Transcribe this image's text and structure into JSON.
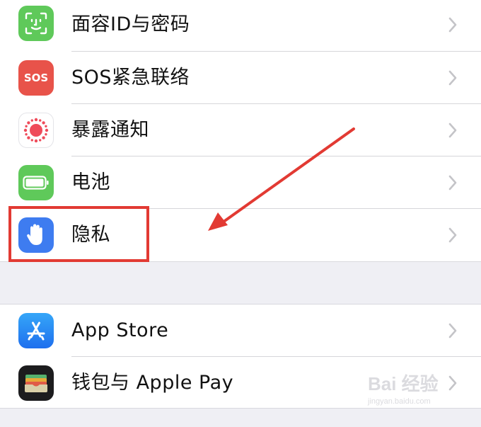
{
  "settings_group_1": {
    "items": [
      {
        "label": "面容ID与密码",
        "icon": "face-id-icon",
        "icon_color": "#5fc95a"
      },
      {
        "label": "SOS紧急联络",
        "icon": "sos-icon",
        "icon_color": "#e8534a",
        "icon_text": "SOS"
      },
      {
        "label": "暴露通知",
        "icon": "exposure-notification-icon",
        "icon_color": "#ffffff"
      },
      {
        "label": "电池",
        "icon": "battery-icon",
        "icon_color": "#5fc95a"
      },
      {
        "label": "隐私",
        "icon": "hand-privacy-icon",
        "icon_color": "#3e7cf0"
      }
    ]
  },
  "settings_group_2": {
    "items": [
      {
        "label": "App Store",
        "icon": "app-store-icon",
        "icon_color": "#2f8bf5"
      },
      {
        "label": "钱包与 Apple Pay",
        "icon": "wallet-icon",
        "icon_color": "#1c1c1e"
      }
    ]
  },
  "annotation": {
    "highlight_color": "#e23a33",
    "highlighted_item": "隐私"
  },
  "watermark": {
    "text": "Bai 经验",
    "subtext": "jingyan.baidu.com"
  }
}
